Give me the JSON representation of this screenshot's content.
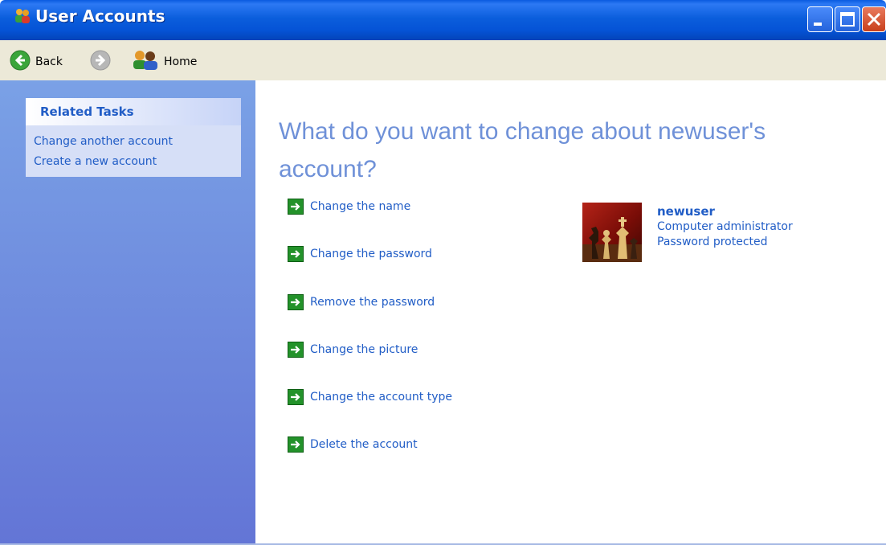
{
  "window": {
    "title": "User Accounts",
    "accent": "#0553d6"
  },
  "toolbar": {
    "back_label": "Back",
    "home_label": "Home"
  },
  "sidebar": {
    "panel_title": "Related Tasks",
    "links": [
      "Change another account",
      "Create a new account"
    ]
  },
  "main": {
    "heading": "What do you want to change about newuser's account?",
    "actions": [
      "Change the name",
      "Change the password",
      "Remove the password",
      "Change the picture",
      "Change the account type",
      "Delete the account"
    ],
    "user": {
      "name": "newuser",
      "type": "Computer administrator",
      "status": "Password protected"
    }
  },
  "icons": [
    "user-accounts-icon",
    "back-arrow-icon",
    "forward-arrow-icon",
    "home-users-icon",
    "green-arrow-icon",
    "chess-avatar"
  ]
}
